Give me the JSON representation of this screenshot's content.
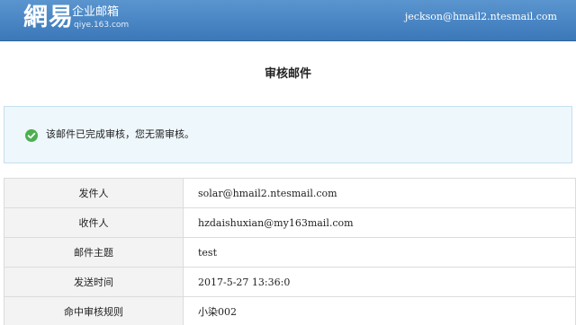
{
  "header": {
    "logo_mark": "網易",
    "logo_title": "企业邮箱",
    "logo_domain": "qiye.163.com",
    "user_email": "jeckson@hmail2.ntesmail.com",
    "brand_color": "#4a87c6"
  },
  "page": {
    "title": "审核邮件"
  },
  "notice": {
    "icon": "check-circle-icon",
    "icon_color": "#4caf50",
    "text": "该邮件已完成审核，您无需审核。"
  },
  "details": {
    "rows": [
      {
        "label": "发件人",
        "value": "solar@hmail2.ntesmail.com"
      },
      {
        "label": "收件人",
        "value": "hzdaishuxian@my163mail.com"
      },
      {
        "label": "邮件主题",
        "value": "test"
      },
      {
        "label": "发送时间",
        "value": "2017-5-27 13:36:0"
      },
      {
        "label": "命中审核规则",
        "value": "小染002"
      }
    ]
  }
}
